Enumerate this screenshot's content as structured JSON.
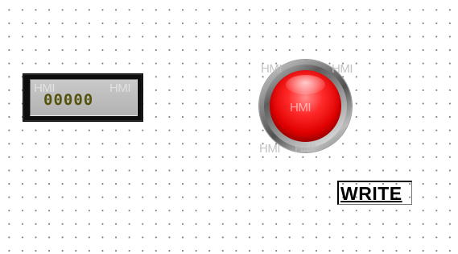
{
  "numeric_display": {
    "value": "00000",
    "watermark_left": "HMI",
    "watermark_right": "HMI",
    "value_color": "#55520b"
  },
  "indicator_lamp": {
    "state_color": "#e00000",
    "watermark_top_left": "HMI",
    "watermark_top_right": "HMI",
    "watermark_center": "HMI",
    "watermark_bottom_left": "HMI",
    "watermark_bottom_right": "HMI"
  },
  "write_button": {
    "label": "WRITE"
  },
  "canvas": {
    "grid": "dotted",
    "background": "#ffffff",
    "dot_color": "#7c7c7c"
  }
}
